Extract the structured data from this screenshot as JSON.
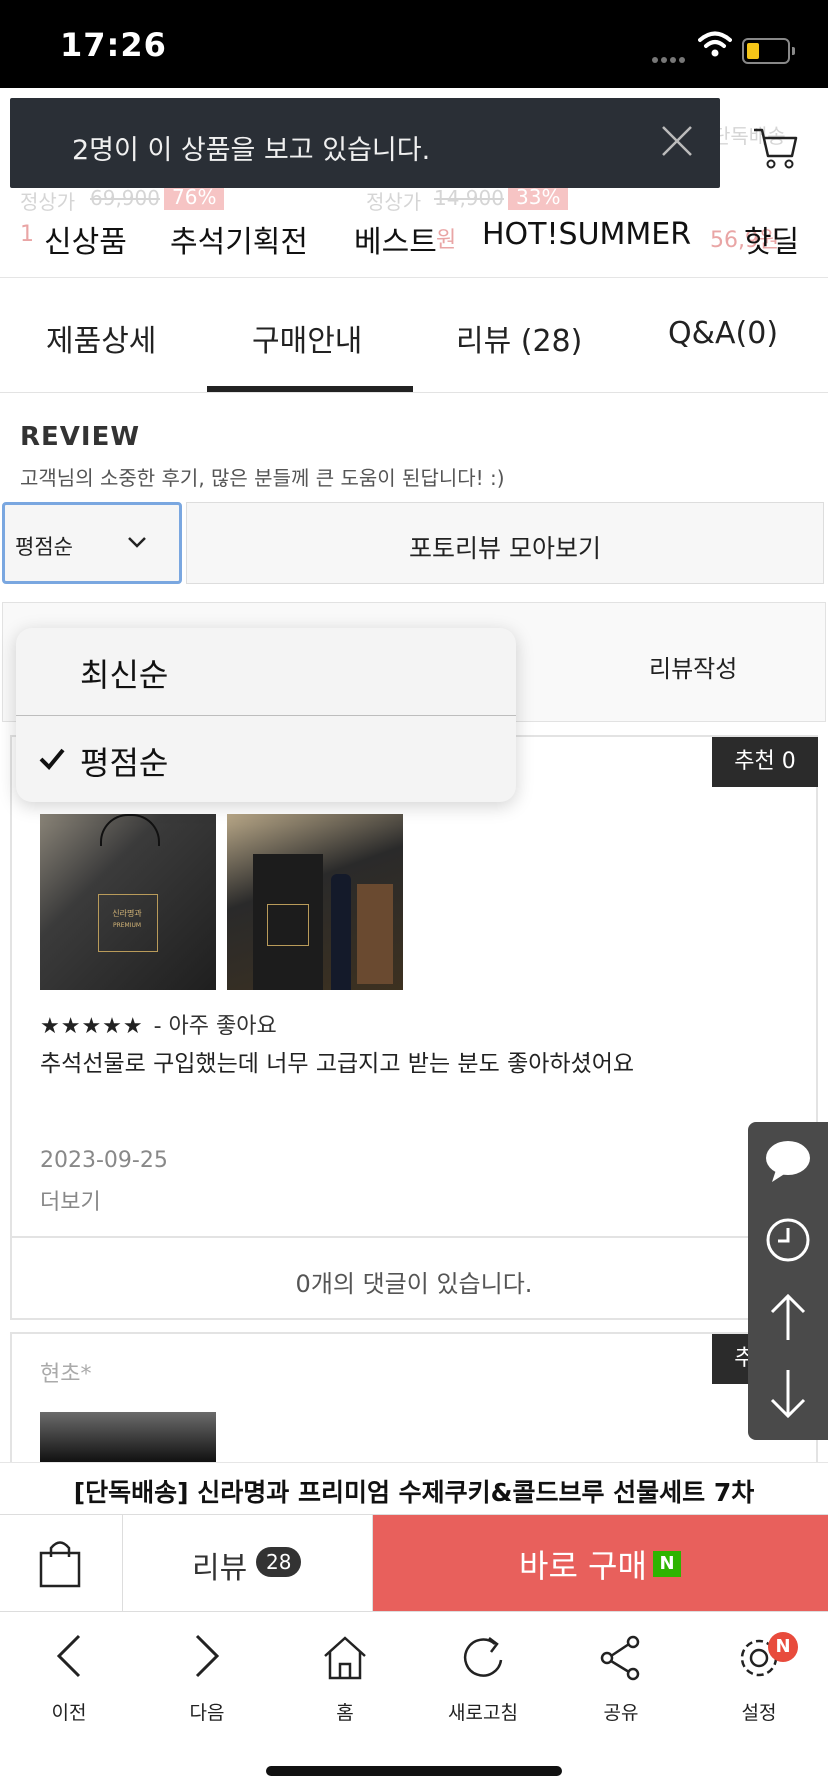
{
  "status_bar": {
    "time": "17:26"
  },
  "background": {
    "corner_text": "단독배송",
    "items": [
      {
        "label": "정상가",
        "old": "69,900",
        "pct": "76%",
        "price": "1"
      },
      {
        "label": "정상가",
        "old": "14,900",
        "pct": "33%",
        "price": "원"
      },
      {
        "price": "56,9원"
      }
    ]
  },
  "toast": {
    "message": "2명이 이 상품을 보고 있습니다."
  },
  "category_nav": [
    "신상품",
    "추석기획전",
    "베스트",
    "HOT!SUMMER",
    "핫딜"
  ],
  "tabs": [
    "제품상세",
    "구매안내",
    "리뷰 (28)",
    "Q&A(0)"
  ],
  "active_tab": "구매안내",
  "review_section": {
    "title": "REVIEW",
    "subtitle": "고객님의 소중한 후기, 많은 분들께 큰 도움이 된답니다! :)",
    "sort_selected": "평점순",
    "photo_review_button": "포토리뷰 모아보기",
    "write_button": "리뷰작성"
  },
  "sort_dropdown": {
    "options": [
      "최신순",
      "평점순"
    ],
    "selected": "평점순"
  },
  "review_card": {
    "recommend": "추천 0",
    "stars": "★★★★★",
    "grade": "- 아주 좋아요",
    "content": "추석선물로 구입했는데 너무 고급지고 받는 분도 좋아하셨어요",
    "date": "2023-09-25",
    "more": "더보기",
    "comments": "0개의 댓글이 있습니다."
  },
  "review_card_2": {
    "author": "현초*",
    "recommend": "추천 0"
  },
  "thumb_text": {
    "brand": "신라명과",
    "premium": "PREMIUM"
  },
  "side_rail": [
    "chat-icon",
    "recent-icon",
    "scroll-top-icon",
    "scroll-bottom-icon"
  ],
  "product_title": "[단독배송] 신라명과 프리미엄 수제쿠키&콜드브루 선물세트 7차",
  "buy_bar": {
    "review_label": "리뷰",
    "review_count": "28",
    "buy_label": "바로 구매",
    "naver_badge": "N"
  },
  "toolbar": [
    {
      "icon": "back-icon",
      "label": "이전"
    },
    {
      "icon": "forward-icon",
      "label": "다음"
    },
    {
      "icon": "home-icon",
      "label": "홈"
    },
    {
      "icon": "refresh-icon",
      "label": "새로고침"
    },
    {
      "icon": "share-icon",
      "label": "공유"
    },
    {
      "icon": "settings-icon",
      "label": "설정"
    }
  ],
  "settings_badge": "N",
  "colors": {
    "buy": "#e8605c",
    "toast": "#2a2f36",
    "naver": "#2db400",
    "focus": "#7aa7e0"
  }
}
